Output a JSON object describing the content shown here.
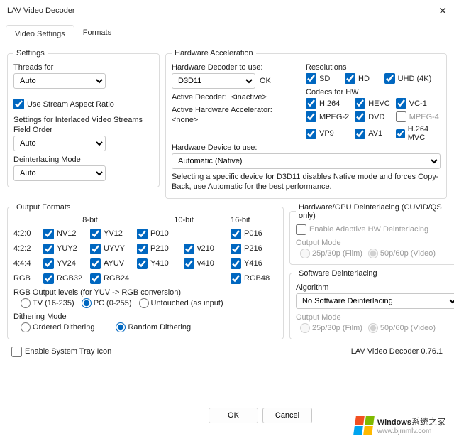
{
  "window": {
    "title": "LAV Video Decoder"
  },
  "tabs": {
    "video": "Video Settings",
    "formats": "Formats"
  },
  "settings": {
    "legend": "Settings",
    "threads_label": "Threads for",
    "threads_value": "Auto",
    "use_stream_ar": "Use Stream Aspect Ratio",
    "interlaced_label": "Settings for Interlaced Video Streams",
    "field_order_label": "Field Order",
    "field_order_value": "Auto",
    "deint_mode_label": "Deinterlacing Mode",
    "deint_mode_value": "Auto"
  },
  "hw": {
    "legend": "Hardware Acceleration",
    "decoder_label": "Hardware Decoder to use:",
    "decoder_value": "D3D11",
    "ok": "OK",
    "active_decoder_label": "Active Decoder:",
    "active_decoder_value": "<inactive>",
    "active_accel_label": "Active Hardware Accelerator:",
    "active_accel_value": "<none>",
    "device_label": "Hardware Device to use:",
    "device_value": "Automatic (Native)",
    "note": "Selecting a specific device for D3D11 disables Native mode and forces Copy-Back, use Automatic for the best performance.",
    "res_label": "Resolutions",
    "res": {
      "sd": "SD",
      "hd": "HD",
      "uhd": "UHD (4K)"
    },
    "codecs_label": "Codecs for HW",
    "codecs": {
      "h264": "H.264",
      "hevc": "HEVC",
      "vc1": "VC-1",
      "mpeg2": "MPEG-2",
      "dvd": "DVD",
      "mpeg4": "MPEG-4",
      "vp9": "VP9",
      "av1": "AV1",
      "h264mvc": "H.264 MVC"
    }
  },
  "of": {
    "legend": "Output Formats",
    "hdr8": "8-bit",
    "hdr10": "10-bit",
    "hdr16": "16-bit",
    "r420": "4:2:0",
    "r422": "4:2:2",
    "r444": "4:4:4",
    "rrgb": "RGB",
    "nv12": "NV12",
    "yv12": "YV12",
    "p010": "P010",
    "p016": "P016",
    "yuy2": "YUY2",
    "uyvy": "UYVY",
    "p210": "P210",
    "v210": "v210",
    "p216": "P216",
    "yv24": "YV24",
    "ayuv": "AYUV",
    "y410": "Y410",
    "v410": "v410",
    "y416": "Y416",
    "rgb32": "RGB32",
    "rgb24": "RGB24",
    "rgb48": "RGB48",
    "rgb_levels_label": "RGB Output levels (for YUV -> RGB conversion)",
    "tv": "TV (16-235)",
    "pc": "PC (0-255)",
    "untouched": "Untouched (as input)",
    "dither_label": "Dithering Mode",
    "ordered": "Ordered Dithering",
    "random": "Random Dithering"
  },
  "de": {
    "hw_legend": "Hardware/GPU Deinterlacing (CUVID/QS only)",
    "enable_adaptive": "Enable Adaptive HW Deinterlacing",
    "output_mode": "Output Mode",
    "r25": "25p/30p (Film)",
    "r50": "50p/60p (Video)",
    "sw_legend": "Software Deinterlacing",
    "algo_label": "Algorithm",
    "algo_value": "No Software Deinterlacing"
  },
  "footer": {
    "tray": "Enable System Tray Icon",
    "version": "LAV Video Decoder 0.76.1",
    "ok": "OK",
    "cancel": "Cancel"
  },
  "brand": {
    "name": "Windows",
    "sub": "系统之家",
    "url": "www.bjmmlv.com"
  }
}
